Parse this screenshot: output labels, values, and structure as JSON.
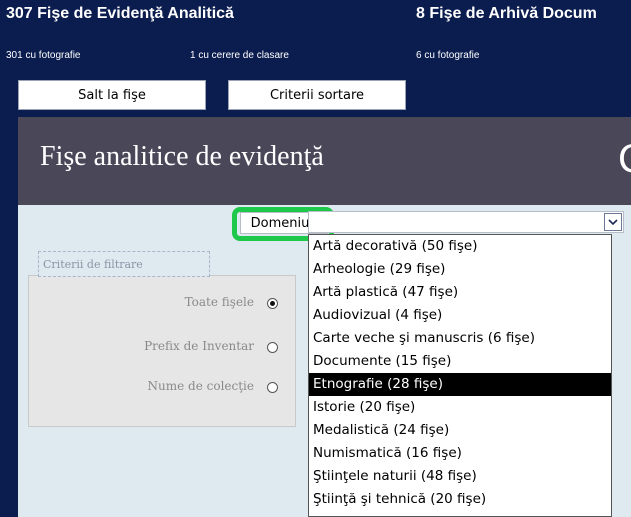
{
  "header": {
    "left_title": "307 Fişe de Evidenţă Analitică",
    "left_with_photo": "301 cu fotografie",
    "left_classify": "1 cu cerere de clasare",
    "right_title": "8 Fişe de Arhivă Docum",
    "right_with_photo": "6 cu fotografie"
  },
  "buttons": {
    "jump": "Salt la fişe",
    "sort": "Criterii sortare"
  },
  "banner": {
    "title": "Fişe analitice de evidenţă",
    "peek": "C"
  },
  "domain": {
    "label": "Domeniul:",
    "value": ""
  },
  "filter": {
    "legend": "Criterii de filtrare",
    "options": [
      {
        "label": "Toate fişele",
        "selected": true
      },
      {
        "label": "Prefix de Inventar",
        "selected": false
      },
      {
        "label": "Nume de colecţie",
        "selected": false
      }
    ]
  },
  "dropdown": {
    "items": [
      "Artă decorativă  (50 fişe)",
      "Arheologie  (29 fişe)",
      "Artă plastică  (47 fişe)",
      "Audiovizual  (4 fişe)",
      "Carte veche şi manuscris  (6 fişe)",
      "Documente  (15 fişe)",
      "Etnografie  (28 fişe)",
      "Istorie  (20 fişe)",
      "Medalistică  (24 fişe)",
      "Numismatică  (16 fişe)",
      "Ştiinţele naturii  (48 fişe)",
      "Ştiinţă şi tehnică  (20 fişe)"
    ],
    "selected_index": 6
  },
  "colors": {
    "background": "#0b1d4f",
    "banner": "#4a4759",
    "panel": "#dfe9f0",
    "highlight": "#1ec84a"
  }
}
